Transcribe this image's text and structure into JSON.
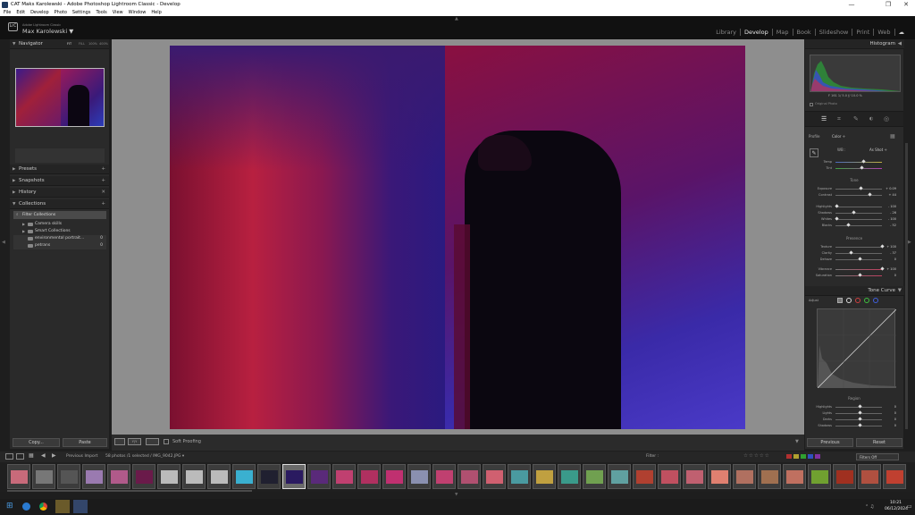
{
  "window": {
    "title": "CAT Maks Karolewski - Adobe Photoshop Lightroom Classic - Develop",
    "controls": [
      "—",
      "❐",
      "✕"
    ]
  },
  "menu": [
    "File",
    "Edit",
    "Develop",
    "Photo",
    "Settings",
    "Tools",
    "View",
    "Window",
    "Help"
  ],
  "identity": {
    "badge": "LrC",
    "app_name": "Adobe Lightroom Classic",
    "user_name": "Max Karolewski ▼"
  },
  "modules": [
    "Library",
    "Develop",
    "Map",
    "Book",
    "Slideshow",
    "Print",
    "Web"
  ],
  "left": {
    "navigator": {
      "title": "Navigator",
      "zoom": [
        "FIT",
        "FILL",
        "100%",
        "400%"
      ]
    },
    "panels": [
      "Presets",
      "Snapshots",
      "History",
      "Collections"
    ],
    "collections": [
      {
        "name": "Filter Collections",
        "count": ""
      },
      {
        "name": "Camera skills",
        "count": ""
      },
      {
        "name": "Smart Collections",
        "count": ""
      },
      {
        "name": "environmental portrait...",
        "count": "0"
      },
      {
        "name": "petrans",
        "count": "0"
      }
    ],
    "copy_label": "Copy...",
    "paste_label": "Paste"
  },
  "toolbar": {
    "soft_proofing": "Soft Proofing"
  },
  "right": {
    "histogram": {
      "title": "Histogram",
      "readout": "F  161  1/  5.0  ƒ/  10.0  %",
      "original_photo": "Original Photo"
    },
    "basic": {
      "profile_label": "Profile",
      "profile_value": "Color ÷",
      "wb_label": "WB :",
      "wb_value": "As Shot ÷",
      "temp_label": "Temp",
      "tint_label": "Tint",
      "tone_label": "Tone",
      "exposure_label": "Exposure",
      "exposure_value": "+ 0.09",
      "contrast_label": "Contrast",
      "contrast_value": "+ 44",
      "highlights_label": "Highlights",
      "highlights_value": "- 100",
      "shadows_label": "Shadows",
      "shadows_value": "- 26",
      "whites_label": "Whites",
      "whites_value": "- 100",
      "blacks_label": "Blacks",
      "blacks_value": "- 52",
      "presence_label": "Presence",
      "texture_label": "Texture",
      "texture_value": "+ 100",
      "clarity_label": "Clarity",
      "clarity_value": "- 37",
      "dehaze_label": "Dehaze",
      "dehaze_value": "0",
      "vibrance_label": "Vibrance",
      "vibrance_value": "+ 100",
      "saturation_label": "Saturation",
      "saturation_value": "0"
    },
    "tone_curve": {
      "title": "Tone Curve",
      "adjust_label": "Adjust",
      "region_label": "Region",
      "highlights_label": "Highlights",
      "highlights_value": "0",
      "lights_label": "Lights",
      "lights_value": "0",
      "darks_label": "Darks",
      "darks_value": "0",
      "shadows_label": "Shadows",
      "shadows_value": "0"
    },
    "previous_label": "Previous",
    "reset_label": "Reset"
  },
  "filmbar": {
    "source": "Previous Import",
    "count": "58 photos /1 selected / IMG_9042.JPG ▾",
    "filter_label": "Filter :",
    "filters_off": "Filters Off"
  },
  "clock": {
    "time": "10:21",
    "date": "06/12/2024"
  },
  "colors": {
    "accent_thumb": "#dddddd",
    "panel": "#2a2a2a",
    "background": "#1e1e1e"
  }
}
